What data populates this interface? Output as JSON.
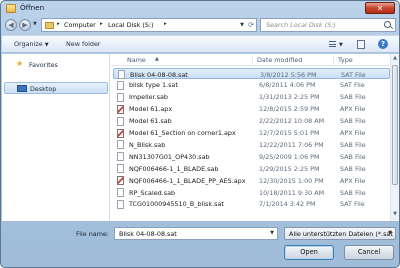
{
  "window": {
    "title": "Öffnen"
  },
  "address": {
    "breadcrumbs": [
      "Computer",
      "Local Disk (S:)"
    ],
    "search_placeholder": "Search Local Disk (S:)"
  },
  "toolbar": {
    "organize": "Organize",
    "new_folder": "New folder"
  },
  "nav": {
    "items": [
      {
        "label": "Favorites",
        "icon": "star-icon"
      },
      {
        "label": "Desktop",
        "icon": "desktop-icon",
        "selected": true
      }
    ]
  },
  "columns": {
    "name": "Name",
    "date": "Date modified",
    "type": "Type"
  },
  "files": [
    {
      "name": "Blisk 04-08-08.sat",
      "date": "3/8/2012 5:56 PM",
      "type": "SAT File",
      "selected": true
    },
    {
      "name": "blisk type 1.sat",
      "date": "6/8/2011 4:06 PM",
      "type": "SAT File"
    },
    {
      "name": "Impeller.sab",
      "date": "1/31/2013 2:25 PM",
      "type": "SAB File"
    },
    {
      "name": "Model 61.apx",
      "date": "12/8/2015 2:59 PM",
      "type": "APX File"
    },
    {
      "name": "Model 61.sab",
      "date": "2/22/2012 10:08 AM",
      "type": "SAB File"
    },
    {
      "name": "Model 61_Section on corner1.apx",
      "date": "12/7/2015 5:01 PM",
      "type": "APX File"
    },
    {
      "name": "N_Blisk.sab",
      "date": "12/22/2011 7:06 PM",
      "type": "SAB File"
    },
    {
      "name": "NN31307G01_OP430.sab",
      "date": "9/25/2009 1:06 PM",
      "type": "SAB File"
    },
    {
      "name": "NQF006466-1_1_BLADE.sab",
      "date": "1/29/2015 2:25 PM",
      "type": "SAB File"
    },
    {
      "name": "NQF006466-1_1_BLADE_PP_AES.apx",
      "date": "12/30/2015 1:00 PM",
      "type": "APX File"
    },
    {
      "name": "RP_Scaled.sab",
      "date": "10/18/2011 9:30 AM",
      "type": "SAB File"
    },
    {
      "name": "TCG01000945510_B_blisk.sat",
      "date": "7/1/2014 3:42 PM",
      "type": "SAT File"
    }
  ],
  "footer": {
    "filename_label": "File name:",
    "filename_value": "Blisk 04-08-08.sat",
    "filetype_value": "Alle unterstützten Dateien (*.sat",
    "open_label": "Open",
    "cancel_label": "Cancel"
  }
}
